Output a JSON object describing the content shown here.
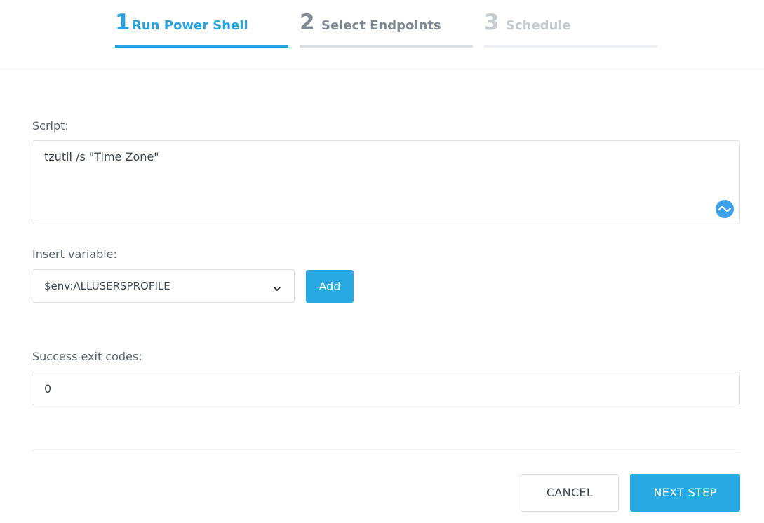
{
  "stepper": {
    "steps": [
      {
        "number": "1",
        "label": "Run Power Shell",
        "state": "active"
      },
      {
        "number": "2",
        "label": "Select Endpoints",
        "state": "next"
      },
      {
        "number": "3",
        "label": "Schedule",
        "state": "future"
      }
    ]
  },
  "script": {
    "label": "Script:",
    "value": "tzutil /s \"Time Zone\"",
    "assist_icon": "wave-icon"
  },
  "variable": {
    "label": "Insert variable:",
    "selected": "$env:ALLUSERSPROFILE",
    "add_label": "Add"
  },
  "exit_codes": {
    "label": "Success exit codes:",
    "value": "0"
  },
  "footer": {
    "cancel_label": "CANCEL",
    "next_label": "NEXT STEP"
  },
  "colors": {
    "accent": "#29a9e1",
    "inactive_text": "#7f8893",
    "disabled_text": "#c6cbd1"
  }
}
